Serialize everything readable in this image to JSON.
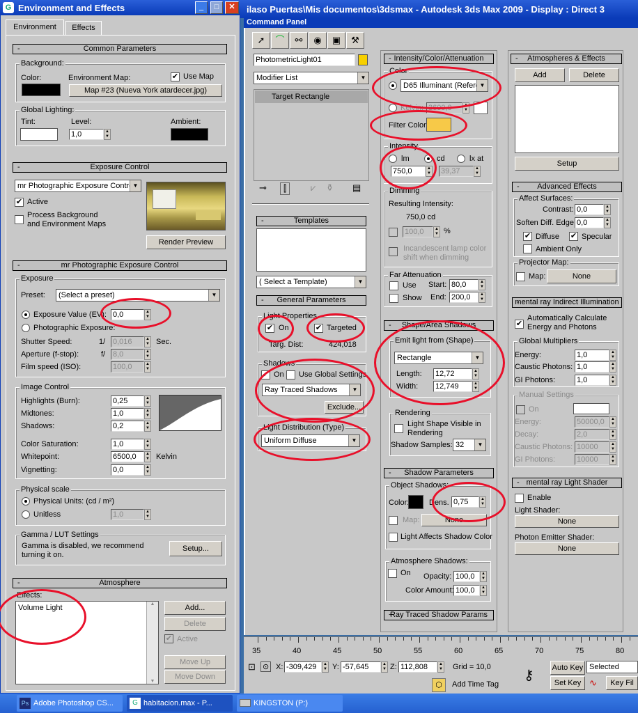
{
  "env": {
    "title": "Environment and Effects",
    "tabs": [
      "Environment",
      "Effects"
    ],
    "common": {
      "header": "Common Parameters",
      "background": "Background:",
      "color": "Color:",
      "env_map": "Environment Map:",
      "use_map": "Use Map",
      "map_button": "Map #23 (Nueva York atardecer.jpg)",
      "global": "Global Lighting:",
      "tint": "Tint:",
      "level": "Level:",
      "level_val": "1,0",
      "ambient": "Ambient:"
    },
    "exposure": {
      "header": "Exposure Control",
      "dropdown": "mr Photographic Exposure Contro",
      "active": "Active",
      "process": "Process Background",
      "process2": "and Environment Maps",
      "render": "Render Preview"
    },
    "mr": {
      "header": "mr Photographic Exposure Control",
      "exposure": "Exposure",
      "preset": "Preset:",
      "preset_val": "(Select a preset)",
      "ev": "Exposure Value (EV):",
      "ev_val": "0,0",
      "photo": "Photographic Exposure:",
      "shutter": "Shutter Speed:",
      "shutter_pre": "1/",
      "shutter_val": "0,016",
      "sec": "Sec.",
      "aperture": "Aperture (f-stop):",
      "aperture_pre": "f/",
      "aperture_val": "8,0",
      "film": "Film speed (ISO):",
      "film_val": "100,0",
      "image": "Image Control",
      "high": "Highlights (Burn):",
      "high_val": "0,25",
      "mid": "Midtones:",
      "mid_val": "1,0",
      "shadows": "Shadows:",
      "shadows_val": "0,2",
      "sat": "Color Saturation:",
      "sat_val": "1,0",
      "white": "Whitepoint:",
      "white_val": "6500,0",
      "kelvin": "Kelvin",
      "vig": "Vignetting:",
      "vig_val": "0,0",
      "physical": "Physical scale",
      "units": "Physical Units: (cd / m²)",
      "unitless": "Unitless",
      "unitless_val": "1,0",
      "gamma": "Gamma / LUT Settings",
      "gamma_msg1": "Gamma is disabled, we recommend",
      "gamma_msg2": "turning it on.",
      "setup": "Setup..."
    },
    "atmo": {
      "header": "Atmosphere",
      "effects": "Effects:",
      "item": "Volume Light",
      "add": "Add...",
      "delete": "Delete",
      "active": "Active",
      "up": "Move Up",
      "down": "Move Down"
    }
  },
  "max": {
    "title": "ilaso Puertas\\Mis documentos\\3dsmax        - Autodesk 3ds Max  2009          - Display : Direct 3",
    "cmd": "Command Panel",
    "objname": "PhotometricLight01",
    "modlist": "Modifier List",
    "stack": "Target Rectangle",
    "templates": {
      "header": "Templates",
      "select": "( Select a Template)"
    },
    "general": {
      "header": "General Parameters",
      "props": "Light Properties",
      "on": "On",
      "targeted": "Targeted",
      "targdist": "Targ. Dist:",
      "targdist_val": "424,018",
      "shadows": "Shadows",
      "use_global": "Use Global Settings",
      "shadow_type": "Ray Traced Shadows",
      "exclude": "Exclude...",
      "dist": "Light Distribution (Type)",
      "dist_val": "Uniform Diffuse"
    },
    "intensity": {
      "header": "Intensity/Color/Attenuation",
      "color": "Color",
      "illum": "D65 Illuminant (Refere",
      "kelvin": "Kelvin:",
      "kelvin_val": "3600,0",
      "filter": "Filter Color:",
      "intensity": "Intensity",
      "lm": "lm",
      "cd": "cd",
      "lx": "lx at",
      "int_val": "750,0",
      "lx_val": "39,37",
      "dimming": "Dimming",
      "resulting": "Resulting Intensity:",
      "res_val": "750,0 cd",
      "pct_val": "100,0",
      "pct": "%",
      "incand1": "Incandescent lamp color",
      "incand2": "shift when dimming",
      "far": "Far Attenuation",
      "use": "Use",
      "start": "Start:",
      "start_val": "80,0",
      "show": "Show",
      "end": "End:",
      "end_val": "200,0"
    },
    "shape": {
      "header": "Shape/Area Shadows",
      "emit": "Emit light from (Shape)",
      "shape_val": "Rectangle",
      "length": "Length:",
      "length_val": "12,72",
      "width": "Width:",
      "width_val": "12,749",
      "rendering": "Rendering",
      "visible1": "Light Shape Visible in",
      "visible2": "Rendering",
      "samples": "Shadow Samples:",
      "samples_val": "32"
    },
    "shadowp": {
      "header": "Shadow Parameters",
      "object": "Object Shadows:",
      "color": "Color:",
      "dens": "Dens.",
      "dens_val": "0,75",
      "map": "Map:",
      "none": "None",
      "affects": "Light Affects Shadow Color",
      "atmo": "Atmosphere Shadows:",
      "on": "On",
      "opacity": "Opacity:",
      "op_val": "100,0",
      "amount": "Color Amount:",
      "amt_val": "100,0"
    },
    "raytraced": "Ray Traced Shadow Params",
    "atmos": {
      "header": "Atmospheres & Effects",
      "add": "Add",
      "delete": "Delete",
      "setup": "Setup"
    },
    "adv": {
      "header": "Advanced Effects",
      "affect": "Affect Surfaces:",
      "contrast": "Contrast:",
      "contrast_val": "0,0",
      "soften": "Soften Diff. Edge:",
      "soften_val": "0,0",
      "diffuse": "Diffuse",
      "specular": "Specular",
      "ambient": "Ambient Only",
      "projector": "Projector Map:",
      "map": "Map:",
      "none": "None"
    },
    "mrii": {
      "header": "mental ray Indirect Illumination",
      "auto1": "Automatically Calculate",
      "auto2": "Energy and Photons",
      "global": "Global Multipliers",
      "energy": "Energy:",
      "energy_val": "1,0",
      "caustic": "Caustic Photons:",
      "caustic_val": "1,0",
      "gi": "GI Photons:",
      "gi_val": "1,0",
      "manual": "Manual Settings",
      "on": "On",
      "m_energy_val": "50000,0",
      "decay": "Decay:",
      "decay_val": "2,0",
      "m_caustic_val": "10000",
      "m_gi_val": "10000"
    },
    "shader": {
      "header": "mental ray Light Shader",
      "enable": "Enable",
      "light": "Light Shader:",
      "none": "None",
      "photon": "Photon Emitter Shader:",
      "none2": "None"
    },
    "ruler": [
      "35",
      "40",
      "45",
      "50",
      "55",
      "60",
      "65",
      "70",
      "75",
      "80"
    ],
    "status": {
      "x": "-309,429",
      "y": "-57,645",
      "z": "112,808",
      "grid": "Grid = 10,0",
      "addtag": "Add Time Tag",
      "autokey": "Auto Key",
      "setkey": "Set Key",
      "selected": "Selected",
      "keyfilters": "Key Fil"
    }
  },
  "taskbar": [
    "Adobe Photoshop CS...",
    "habitacion.max  - P...",
    "KINGSTON (P:)"
  ],
  "colors": {
    "highlight": "#e8102a",
    "filter": "#f7c948"
  }
}
